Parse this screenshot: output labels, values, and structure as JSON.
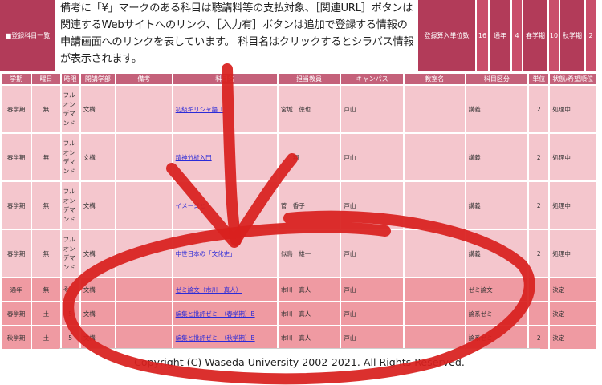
{
  "summary": {
    "label": "■登録科目一覧",
    "notice": "備考に「¥」マークのある科目は聴講料等の支払対象、［関連URL］ボタンは関連するWebサイトへのリンク、［入力有］ボタンは追加で登録する情報の申請画面へのリンクを表しています。 科目名はクリックするとシラバス情報が表示されます。",
    "credit_label": "登録算入単位数",
    "credit_value": "16",
    "full_year_label": "通年",
    "full_year_value": "4",
    "spring_label": "春学期",
    "spring_value": "10",
    "fall_label": "秋学期",
    "fall_value": "2"
  },
  "table": {
    "headers": [
      "学期",
      "曜日",
      "時限",
      "開講学部",
      "備考",
      "科目名",
      "担当教員",
      "キャンパス",
      "教室名",
      "科目区分",
      "単位",
      "状態/希望順位"
    ],
    "rows": [
      {
        "term": "春学期",
        "day": "無",
        "period": "フルオンデマンド",
        "faculty": "文構",
        "note": "",
        "course": "初級ギリシャ語 1",
        "teacher": "宮城　徳也",
        "campus": "戸山",
        "room": "",
        "category": "講義",
        "credits": "2",
        "status": "処理中"
      },
      {
        "term": "春学期",
        "day": "無",
        "period": "フルオンデマンド",
        "faculty": "文構",
        "note": "",
        "course": "精神分析入門",
        "teacher": "　　翔",
        "campus": "戸山",
        "room": "",
        "category": "講義",
        "credits": "2",
        "status": "処理中"
      },
      {
        "term": "春学期",
        "day": "無",
        "period": "フルオンデマンド",
        "faculty": "文構",
        "note": "",
        "course": "イメージと",
        "teacher": "菅　香子",
        "campus": "戸山",
        "room": "",
        "category": "講義",
        "credits": "2",
        "status": "処理中"
      },
      {
        "term": "春学期",
        "day": "無",
        "period": "フルオンデマンド",
        "faculty": "文構",
        "note": "",
        "course": "中世日本の「文化史」",
        "teacher": "似鳥　雄一",
        "campus": "戸山",
        "room": "",
        "category": "講義",
        "credits": "2",
        "status": "処理中"
      },
      {
        "term": "通年",
        "day": "無",
        "period": "そ",
        "faculty": "文構",
        "note": "",
        "course": "ゼミ論文（市川　真人）",
        "teacher": "市川　真人",
        "campus": "戸山",
        "room": "",
        "category": "ゼミ論文",
        "credits": "",
        "status": "決定"
      },
      {
        "term": "春学期",
        "day": "土",
        "period": "5",
        "faculty": "文構",
        "note": "",
        "course": "編集と批評ゼミ　（春学期）B",
        "teacher": "市川　真人",
        "campus": "戸山",
        "room": "",
        "category": "論系ゼミ",
        "credits": "",
        "status": "決定"
      },
      {
        "term": "秋学期",
        "day": "土",
        "period": "5",
        "faculty": "文構",
        "note": "",
        "course": "編集と批評ゼミ　（秋学期）B",
        "teacher": "市川　真人",
        "campus": "戸山",
        "room": "",
        "category": "論系ゼミ",
        "credits": "2",
        "status": "決定"
      }
    ]
  },
  "footer": "Copyright (C) Waseda University 2002-2021. All Rights Reserved.",
  "colors": {
    "header": "#b23b59",
    "row_processing": "#f4c6cd",
    "row_decided": "#ef9aa2",
    "link": "#2b2bd8",
    "annotation_red": "#d8201e"
  }
}
